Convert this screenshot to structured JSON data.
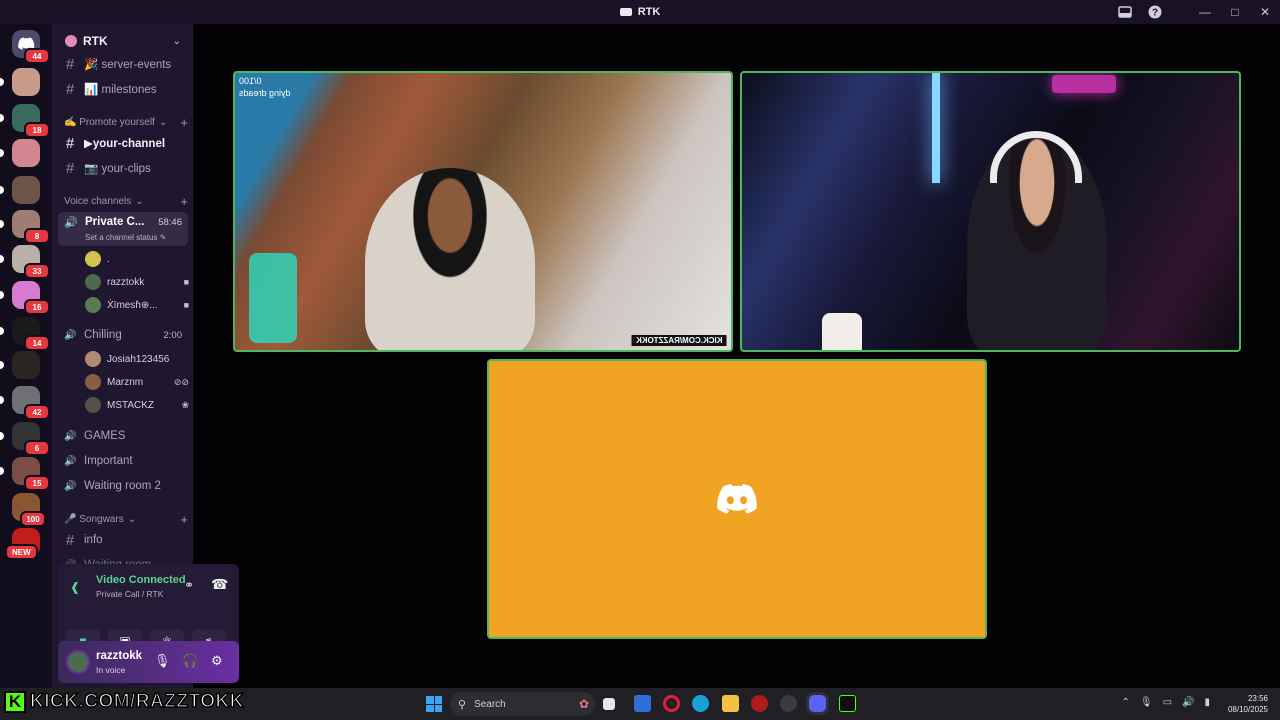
{
  "window": {
    "title": "RTK"
  },
  "rail": {
    "servers": [
      {
        "badge": "44",
        "color": "#4e5d94"
      },
      {
        "badge": "",
        "color": "#c89a8a"
      },
      {
        "badge": "18",
        "color": "#3a6c5e"
      },
      {
        "badge": "",
        "color": "#d2868e"
      },
      {
        "badge": "",
        "color": "#6e5446"
      },
      {
        "badge": "8",
        "color": "#9e7d73"
      },
      {
        "badge": "33",
        "color": "#b9b1a8"
      },
      {
        "badge": "16",
        "color": "#d77bd0"
      },
      {
        "badge": "14",
        "color": "#1a1a1a"
      },
      {
        "badge": "",
        "color": "#2a2522"
      },
      {
        "badge": "42",
        "color": "#6f6f76"
      },
      {
        "badge": "6",
        "color": "#333"
      },
      {
        "badge": "15",
        "color": "#7a4e45"
      },
      {
        "badge": "100",
        "color": "#8a5533"
      },
      {
        "badge": "NEW",
        "color": "#c11b1b"
      }
    ]
  },
  "sidebar": {
    "server_name": "RTK",
    "channels_top": [
      {
        "name": "🎉 server-events"
      },
      {
        "name": "📊 milestones"
      }
    ],
    "cat_promote": "✍️ Promote yourself",
    "channels_promote": [
      {
        "name": "▶your-channel"
      },
      {
        "name": "📷 your-clips"
      }
    ],
    "cat_voice": "Voice channels",
    "private_channel": {
      "name": "Private C...",
      "time": "58:46",
      "status": "Set a channel status ✎"
    },
    "private_users": [
      {
        "name": ".",
        "color": "#d1c24d"
      },
      {
        "name": "razztokk",
        "color": "#4b6a4e"
      },
      {
        "name": "Ẋïmesɦ⊕...",
        "color": "#5a7a52"
      }
    ],
    "chilling": {
      "name": "Chilling",
      "time": "2:00"
    },
    "chilling_users": [
      {
        "name": "Josiah123456",
        "color": "#b08b73"
      },
      {
        "name": "Marznm",
        "color": "#8a5e44"
      },
      {
        "name": "MSTACKZ",
        "color": "#55504a"
      }
    ],
    "voice_more": [
      {
        "name": "GAMES"
      },
      {
        "name": "Important"
      },
      {
        "name": "Waiting room 2"
      }
    ],
    "cat_songwars": "🎤 Songwars",
    "channels_songwars": [
      {
        "name": "info"
      },
      {
        "name": "Waiting room"
      }
    ]
  },
  "voice_panel": {
    "status": "Video Connected",
    "sub": "Private Call / RTK"
  },
  "user_panel": {
    "name": "razztokk",
    "status": "In voice"
  },
  "tiles": {
    "overlay_line1": "0/100",
    "overlay_line2": "dying dreads",
    "kick_tag": "KICK.COM/RAZZTOKK"
  },
  "taskbar": {
    "banner": "KICK.COM/RAZZTOKK",
    "search_placeholder": "Search",
    "time": "23:56",
    "date": "08/10/2025"
  }
}
